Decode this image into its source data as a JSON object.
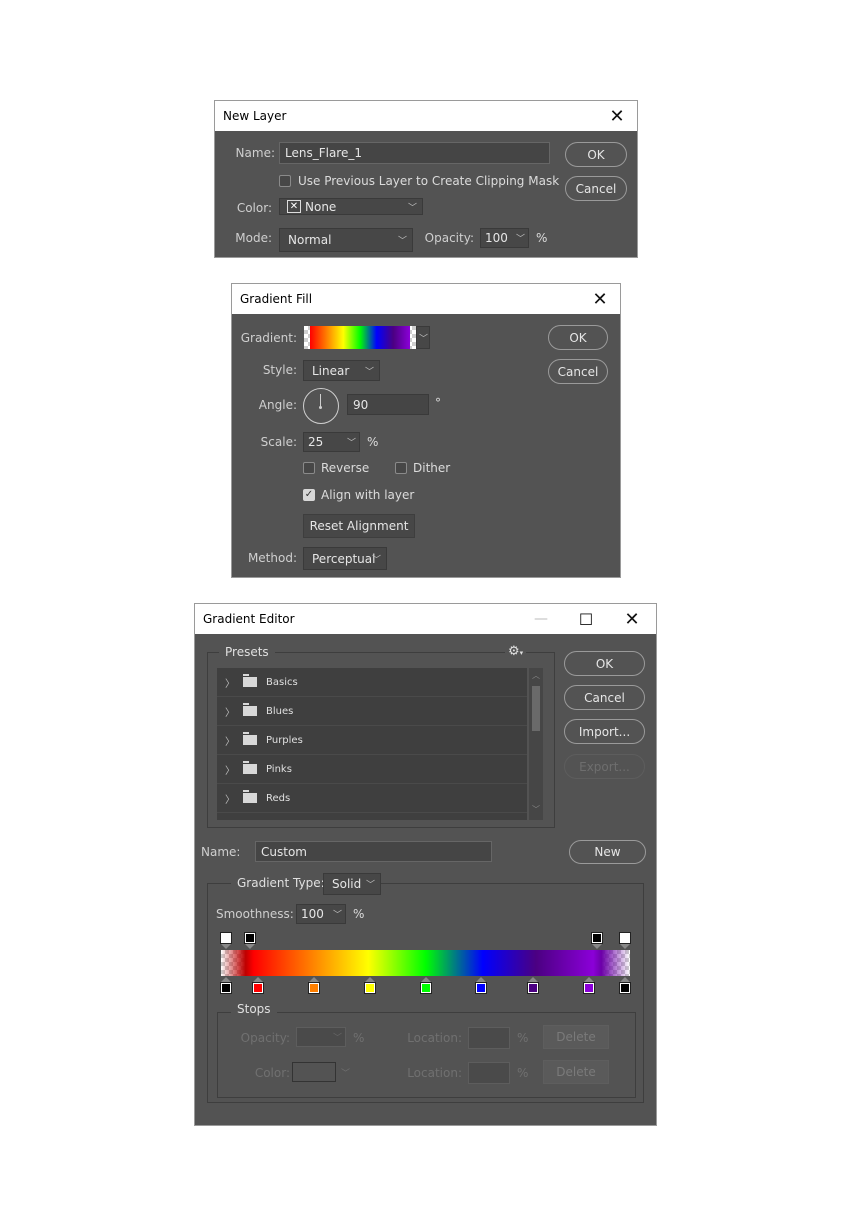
{
  "new_layer": {
    "title": "New Layer",
    "close_icon": "close-icon",
    "name_label": "Name:",
    "name_value": "Lens_Flare_1",
    "clipping_label": "Use Previous Layer to Create Clipping Mask",
    "clipping_checked": false,
    "color_label": "Color:",
    "color_value": "None",
    "mode_label": "Mode:",
    "mode_value": "Normal",
    "opacity_label": "Opacity:",
    "opacity_value": "100",
    "opacity_unit": "%",
    "ok_label": "OK",
    "cancel_label": "Cancel"
  },
  "gradient_fill": {
    "title": "Gradient Fill",
    "gradient_label": "Gradient:",
    "style_label": "Style:",
    "style_value": "Linear",
    "angle_label": "Angle:",
    "angle_value": "90",
    "angle_unit": "°",
    "scale_label": "Scale:",
    "scale_value": "25",
    "scale_unit": "%",
    "reverse_label": "Reverse",
    "reverse_checked": false,
    "dither_label": "Dither",
    "dither_checked": false,
    "align_label": "Align with layer",
    "align_checked": true,
    "reset_label": "Reset Alignment",
    "method_label": "Method:",
    "method_value": "Perceptual",
    "ok_label": "OK",
    "cancel_label": "Cancel"
  },
  "gradient_editor": {
    "title": "Gradient Editor",
    "presets_label": "Presets",
    "presets": [
      {
        "label": "Basics"
      },
      {
        "label": "Blues"
      },
      {
        "label": "Purples"
      },
      {
        "label": "Pinks"
      },
      {
        "label": "Reds"
      }
    ],
    "ok_label": "OK",
    "cancel_label": "Cancel",
    "import_label": "Import...",
    "export_label": "Export...",
    "name_label": "Name:",
    "name_value": "Custom",
    "new_label": "New",
    "type_label": "Gradient Type:",
    "type_value": "Solid",
    "smoothness_label": "Smoothness:",
    "smoothness_value": "100",
    "smoothness_unit": "%",
    "color_stops": [
      {
        "location": 0,
        "color": "#000000"
      },
      {
        "location": 8,
        "color": "#ff0000"
      },
      {
        "location": 22,
        "color": "#ff7f00"
      },
      {
        "location": 36,
        "color": "#ffff00"
      },
      {
        "location": 50,
        "color": "#00ff00"
      },
      {
        "location": 64,
        "color": "#0000ff"
      },
      {
        "location": 77,
        "color": "#4b0082"
      },
      {
        "location": 91,
        "color": "#8b00d8"
      },
      {
        "location": 100,
        "color": "#000000"
      }
    ],
    "opacity_stops": [
      {
        "location": 0,
        "opacity": 0
      },
      {
        "location": 6,
        "opacity": 100
      },
      {
        "location": 93,
        "opacity": 100
      },
      {
        "location": 100,
        "opacity": 0
      }
    ],
    "stops_label": "Stops",
    "opacity_label": "Opacity:",
    "color_label": "Color:",
    "location_label": "Location:",
    "percent": "%",
    "delete_label": "Delete"
  }
}
